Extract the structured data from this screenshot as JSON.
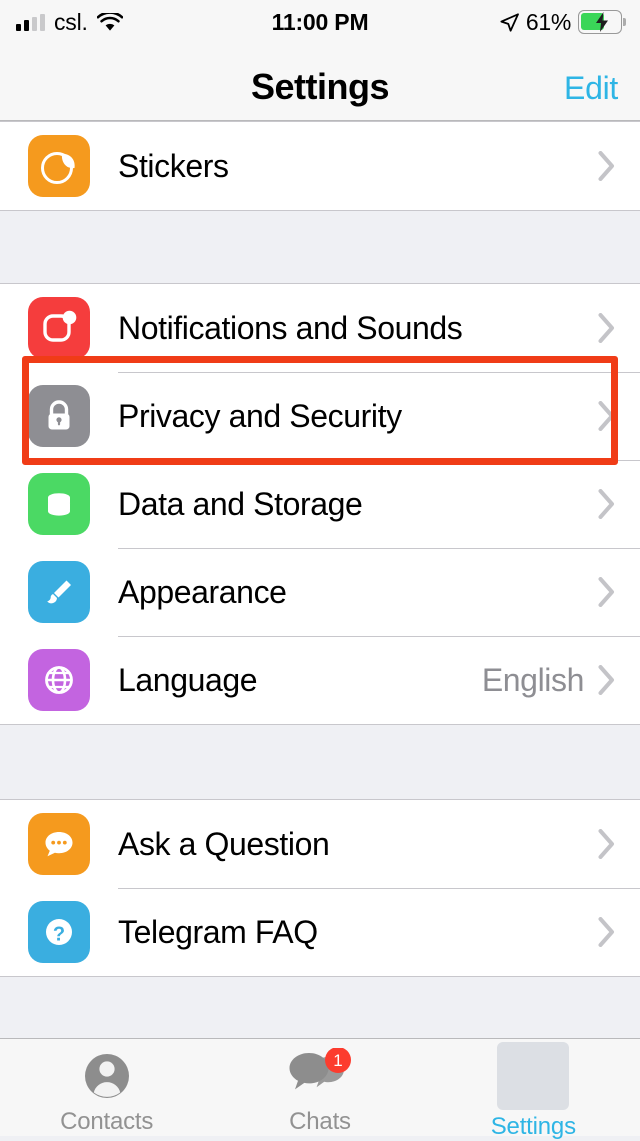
{
  "status_bar": {
    "carrier": "csl.",
    "time": "11:00 PM",
    "battery_percent": "61%",
    "battery_level": 61,
    "signal_bars_filled": 2,
    "signal_bars_total": 4,
    "icons": [
      "signal-bars-icon",
      "wifi-icon",
      "location-arrow-icon",
      "battery-charging-icon"
    ]
  },
  "nav": {
    "title": "Settings",
    "edit_label": "Edit",
    "accent_color": "#2eb5e5"
  },
  "sections": [
    {
      "rows": [
        {
          "label": "Stickers",
          "icon": "stickers-icon",
          "color": "#f59a1e",
          "value": "",
          "chevron": true
        }
      ]
    },
    {
      "rows": [
        {
          "label": "Notifications and Sounds",
          "icon": "notifications-icon",
          "color": "#f53d3d",
          "value": "",
          "chevron": true
        },
        {
          "label": "Privacy and Security",
          "icon": "lock-icon",
          "color": "#8e8e93",
          "value": "",
          "chevron": true,
          "highlighted": true
        },
        {
          "label": "Data and Storage",
          "icon": "database-icon",
          "color": "#4bd964",
          "value": "",
          "chevron": true
        },
        {
          "label": "Appearance",
          "icon": "paintbrush-icon",
          "color": "#3aaee0",
          "value": "",
          "chevron": true
        },
        {
          "label": "Language",
          "icon": "globe-icon",
          "color": "#c364e0",
          "value": "English",
          "chevron": true
        }
      ]
    },
    {
      "rows": [
        {
          "label": "Ask a Question",
          "icon": "speech-bubble-icon",
          "color": "#f59a1e",
          "value": "",
          "chevron": true
        },
        {
          "label": "Telegram FAQ",
          "icon": "question-mark-icon",
          "color": "#3aaee0",
          "value": "",
          "chevron": true
        }
      ]
    }
  ],
  "highlight": {
    "target": "Privacy and Security",
    "color": "#f03c17"
  },
  "tabs": [
    {
      "label": "Contacts",
      "icon": "contacts-person-icon",
      "active": false,
      "badge": ""
    },
    {
      "label": "Chats",
      "icon": "chats-bubbles-icon",
      "active": false,
      "badge": "1"
    },
    {
      "label": "Settings",
      "icon": "settings-placeholder-icon",
      "active": true,
      "badge": ""
    }
  ]
}
